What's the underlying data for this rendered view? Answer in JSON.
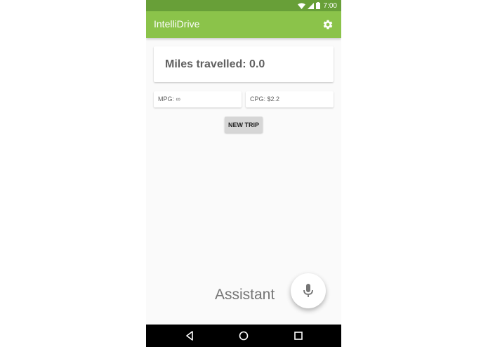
{
  "status_bar": {
    "time": "7:00",
    "icons": [
      "wifi-icon",
      "signal-icon",
      "battery-icon"
    ]
  },
  "app_bar": {
    "title": "IntelliDrive",
    "action_icon": "gear-icon",
    "color": "#8bc34a",
    "status_color": "#689f38"
  },
  "trip": {
    "miles_text": "Miles travelled: 0.0",
    "mpg_text": "MPG: ∞",
    "cpg_text": "CPG: $2.2",
    "new_trip_label": "NEW TRIP"
  },
  "assistant": {
    "label": "Assistant",
    "icon": "microphone-icon"
  },
  "nav_bar": {
    "icons": [
      "back-icon",
      "home-icon",
      "recents-icon"
    ]
  }
}
